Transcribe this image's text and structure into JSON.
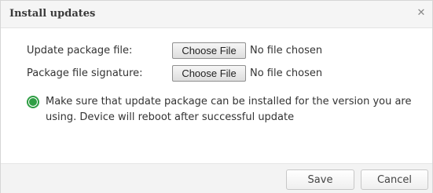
{
  "dialog": {
    "title": "Install updates",
    "close_glyph": "✕",
    "close_icon": "close-icon"
  },
  "form": {
    "update_file": {
      "label": "Update package file:",
      "button_label": "Choose File",
      "status": "No file chosen"
    },
    "signature_file": {
      "label": "Package file signature:",
      "button_label": "Choose File",
      "status": "No file chosen"
    }
  },
  "notice": {
    "icon": "info-icon",
    "icon_color": "#2f9e44",
    "line1": "Make sure that update package can be installed for the version you are",
    "line2": "using. Device will reboot after successful update"
  },
  "footer": {
    "save_label": "Save",
    "cancel_label": "Cancel"
  }
}
